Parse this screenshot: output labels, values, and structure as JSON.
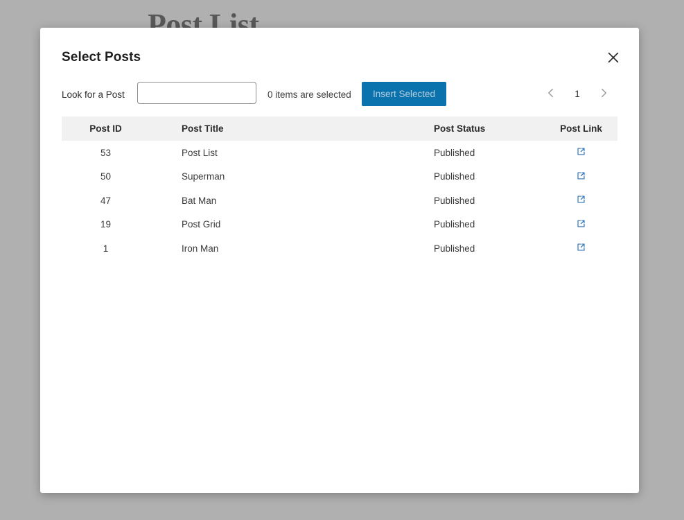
{
  "background_page": {
    "title": "Post List"
  },
  "modal": {
    "title": "Select Posts",
    "close_icon": "close-icon",
    "toolbar": {
      "search_label": "Look for a Post",
      "search_value": "",
      "search_placeholder": "",
      "selected_count_text": "0 items are selected",
      "insert_button_label": "Insert Selected",
      "insert_button_color": "#0a73ae",
      "insert_button_text_color": "#b8cede"
    },
    "pagination": {
      "prev_icon": "chevron-left-icon",
      "next_icon": "chevron-right-icon",
      "current_page": "1"
    },
    "table": {
      "columns": [
        "Post ID",
        "Post Title",
        "Post Status",
        "Post Link"
      ],
      "header_background": "#f1f1f1",
      "link_icon": "external-link-icon",
      "link_icon_color": "#2e73b8",
      "rows": [
        {
          "id": "53",
          "title": "Post List",
          "status": "Published"
        },
        {
          "id": "50",
          "title": "Superman",
          "status": "Published"
        },
        {
          "id": "47",
          "title": "Bat Man",
          "status": "Published"
        },
        {
          "id": "19",
          "title": "Post Grid",
          "status": "Published"
        },
        {
          "id": "1",
          "title": "Iron Man",
          "status": "Published"
        }
      ]
    }
  }
}
